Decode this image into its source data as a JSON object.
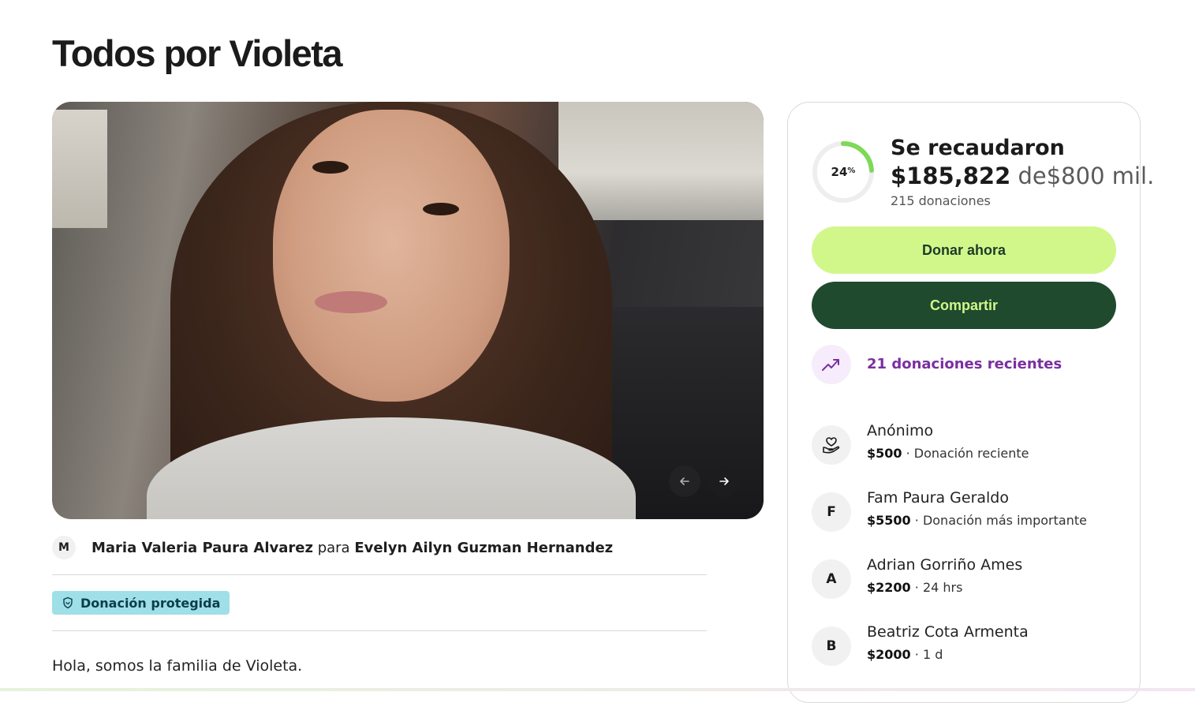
{
  "page": {
    "title": "Todos por Violeta"
  },
  "gallery": {
    "image_alt": "Photo of Violeta",
    "prev_icon": "arrow-left-icon",
    "next_icon": "arrow-right-icon"
  },
  "organizer": {
    "avatar_initial": "M",
    "organizer_name": "Maria Valeria Paura Alvarez",
    "connector": "para",
    "beneficiary_name": "Evelyn Ailyn Guzman Hernandez"
  },
  "badge": {
    "label": "Donación protegida",
    "icon": "shield-icon",
    "color": "#9fdfe7"
  },
  "story": {
    "first_line": "Hola, somos la familia de Violeta."
  },
  "progress": {
    "percent_value": 24,
    "percent_number": "24",
    "percent_sign": "%",
    "raised_label": "Se recaudaron",
    "raised_amount": "$185,822",
    "of_text": "de",
    "goal_amount": "$800 mil.",
    "donations_count": "215 donaciones"
  },
  "actions": {
    "donate_label": "Donar ahora",
    "share_label": "Compartir",
    "donate_color": "#d1f78a",
    "share_color": "#1f4a2e"
  },
  "recent": {
    "label": "21 donaciones recientes",
    "icon": "trending-up-icon",
    "color": "#7a2fa0"
  },
  "donors": [
    {
      "avatar": "",
      "avatar_icon": "heart-hand-icon",
      "name": "Anónimo",
      "amount": "$500",
      "note": "Donación reciente"
    },
    {
      "avatar": "F",
      "name": "Fam Paura Geraldo",
      "amount": "$5500",
      "note": "Donación más importante"
    },
    {
      "avatar": "A",
      "name": "Adrian Gorriño Ames",
      "amount": "$2200",
      "note": "24 hrs"
    },
    {
      "avatar": "B",
      "name": "Beatriz Cota Armenta",
      "amount": "$2000",
      "note": "1 d"
    }
  ]
}
